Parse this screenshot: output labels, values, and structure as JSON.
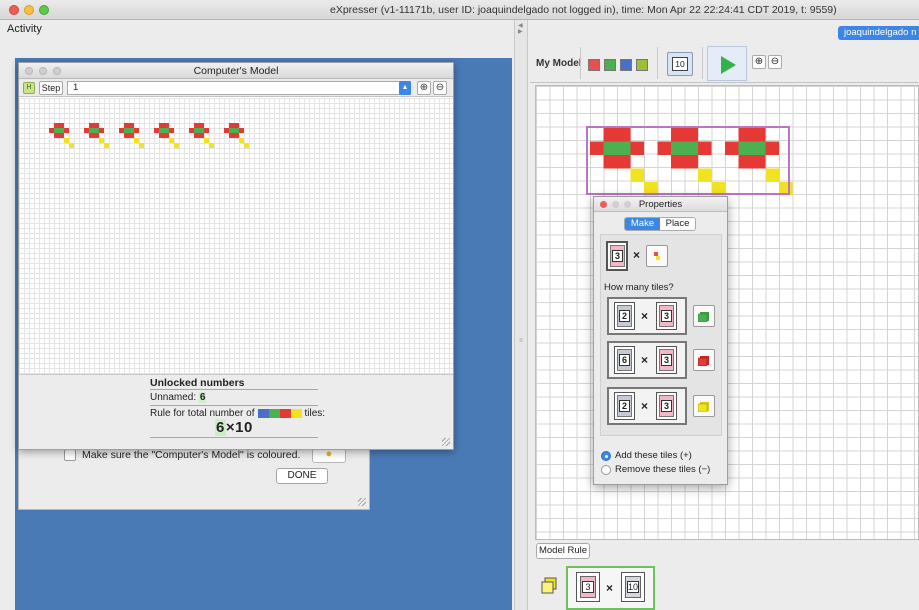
{
  "window": {
    "title": "eXpresser (v1-11171b, user ID: joaquindelgado not logged in), time: Mon Apr 22 22:24:41 CDT 2019, t: 9559)"
  },
  "left": {
    "activity_label": "Activity",
    "checklist_item": "Make sure the \"Computer's Model\" is coloured.",
    "done_label": "DONE"
  },
  "computers_model": {
    "title": "Computer's Model",
    "step_label": "Step",
    "step_value": "1",
    "unlocked_title": "Unlocked numbers",
    "unnamed_label": "Unnamed:",
    "unnamed_value": "6",
    "rule_label": "Rule for total number of",
    "rule_suffix": "tiles:",
    "rule_num": "6",
    "rule_rest": "×10"
  },
  "right": {
    "user_label": "joaquindelgado n",
    "my_model_label": "My Model",
    "number_value": "10",
    "swatch_colors": [
      "#e55050",
      "#4caf50",
      "#4a6fc9",
      "#9bbf3a"
    ],
    "model_rule_label": "Model Rule",
    "model_rule": {
      "left": "3",
      "times": "×",
      "right": "10"
    }
  },
  "properties": {
    "title": "Properties",
    "tab_make": "Make",
    "tab_place": "Place",
    "top_value": "3",
    "times": "×",
    "how_many_label": "How many tiles?",
    "rows": [
      {
        "left": "2",
        "right": "3",
        "color": "#4caf50"
      },
      {
        "left": "6",
        "right": "3",
        "color": "#e53935"
      },
      {
        "left": "2",
        "right": "3",
        "color": "#f2e320"
      }
    ],
    "add_label": "Add these tiles (+)",
    "remove_label": "Remove these tiles (−)"
  },
  "colors": {
    "red": "#e53935",
    "green": "#4caf50",
    "yellow": "#f2e320",
    "accent": "#3c86e5"
  }
}
